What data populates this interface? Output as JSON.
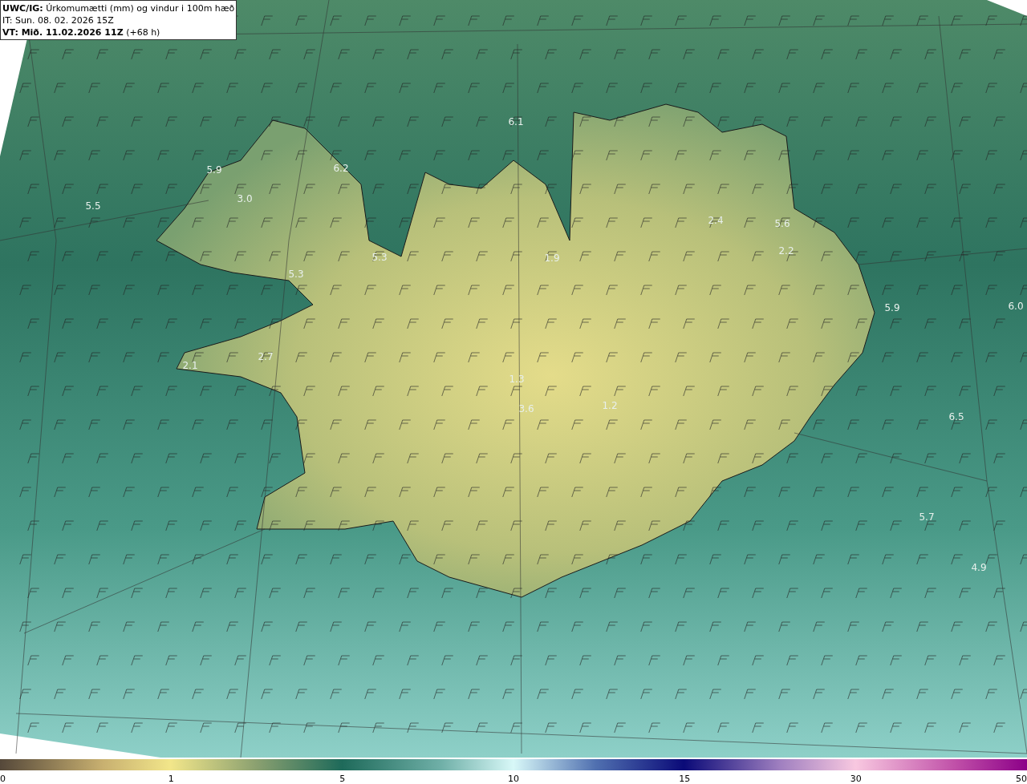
{
  "title_box": {
    "lines": [
      "**UWC/IG:** Úrkomumætti (mm) og vindur i 100m hæð",
      "IT: Sun. 08. 02. 2026 15Z",
      "**VT: Mið. 11.02.2026 11Z** (+68 h)"
    ]
  },
  "map": {
    "value_labels": [
      "6.1",
      "6.2",
      "5.9",
      "3.0",
      "5.5",
      "2.4",
      "5.6",
      "2.2",
      "5.3",
      "1.9",
      "5.3",
      "5.9",
      "6.0",
      "2.7",
      "2.1",
      "1.3",
      "3.6",
      "1.2",
      "6.5",
      "5.7",
      "4.9"
    ]
  },
  "colorbar": {
    "ticks": [
      "0",
      "1",
      "5",
      "10",
      "15",
      "30",
      "50"
    ]
  }
}
